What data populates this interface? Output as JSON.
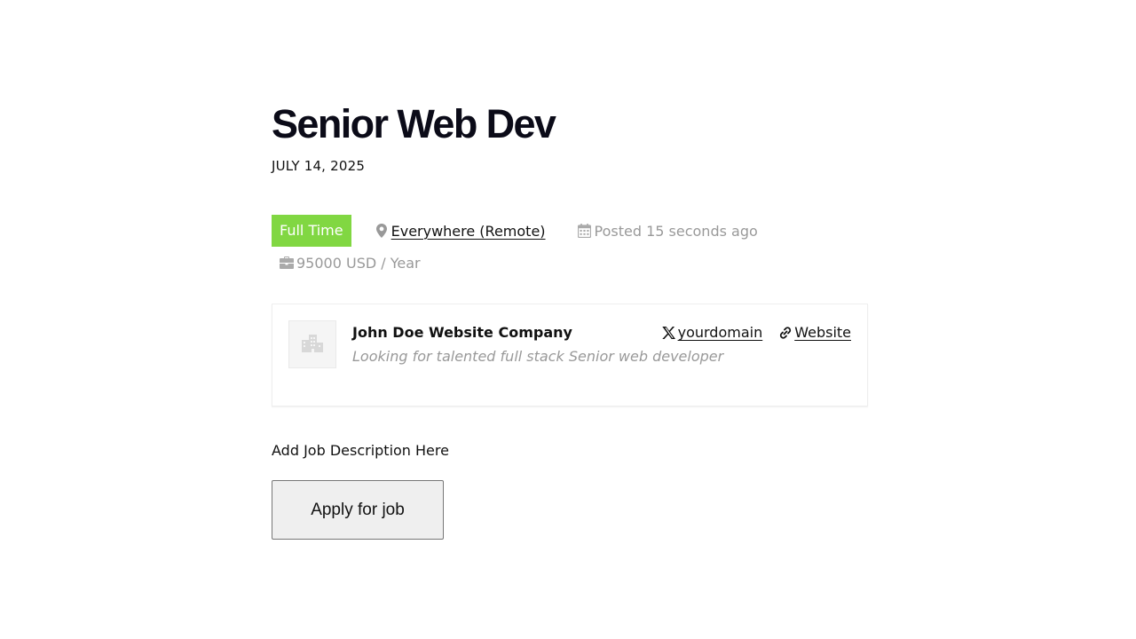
{
  "job": {
    "title": "Senior Web Dev",
    "date": "JULY 14, 2025",
    "type_badge": "Full Time",
    "location": "Everywhere (Remote)",
    "posted": "Posted 15 seconds ago",
    "salary": "95000 USD / Year",
    "description": "Add Job Description Here"
  },
  "company": {
    "name": "John Doe Website Company",
    "tagline": "Looking for talented full stack Senior web developer",
    "twitter_label": "yourdomain",
    "website_label": "Website"
  },
  "actions": {
    "apply_label": "Apply for job"
  },
  "colors": {
    "badge_full_time": "#81d742",
    "muted_text": "#999999"
  },
  "icons": {
    "location": "map-pin-icon",
    "posted": "calendar-icon",
    "salary": "briefcase-icon",
    "twitter": "x-logo-icon",
    "website": "link-icon",
    "company_logo": "building-icon"
  }
}
